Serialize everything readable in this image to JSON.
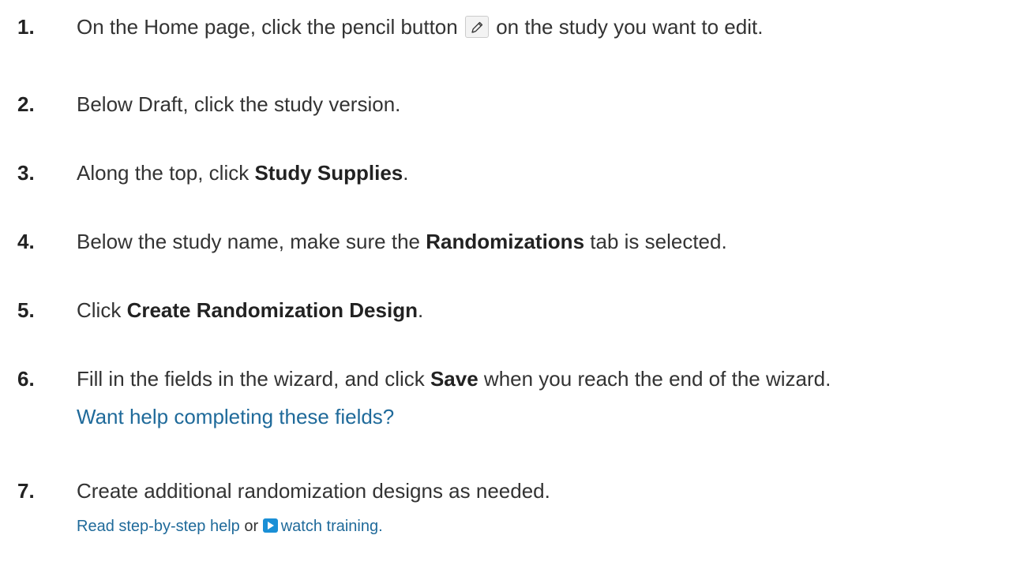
{
  "steps": [
    {
      "number": "1.",
      "before": "On the Home page, click the pencil button",
      "after": "on the study you want to edit.",
      "icon": "pencil-icon"
    },
    {
      "number": "2.",
      "text": "Below Draft, click the study version."
    },
    {
      "number": "3.",
      "before": "Along the top, click ",
      "bold": "Study Supplies",
      "after": "."
    },
    {
      "number": "4.",
      "before": "Below the study name, make sure the ",
      "bold": "Randomizations",
      "after": " tab is selected."
    },
    {
      "number": "5.",
      "before": "Click ",
      "bold": "Create Randomization Design",
      "after": "."
    },
    {
      "number": "6.",
      "before": "Fill in the fields in the wizard, and click ",
      "bold": "Save",
      "after": " when you reach the end of the wizard.",
      "link": "Want help completing these fields?"
    },
    {
      "number": "7.",
      "text": "Create additional randomization designs as needed."
    }
  ],
  "help": {
    "read_link": "Read step-by-step help",
    "or_text": " or ",
    "video_icon": "video-play-icon",
    "watch_link": "watch training."
  },
  "colors": {
    "link": "#1f6a9a",
    "text": "#333333",
    "video_icon": "#1a8fd6"
  }
}
